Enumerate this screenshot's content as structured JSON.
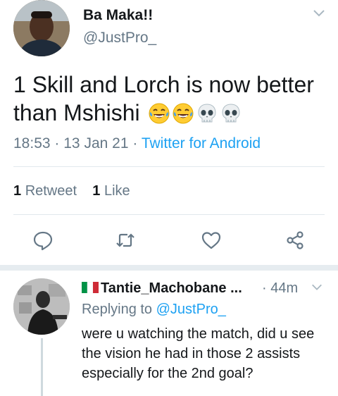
{
  "tweet": {
    "author_name": "Ba Maka!!",
    "author_handle": "@JustPro_",
    "text": "1 Skill and Lorch is now better than Mshishi",
    "emojis": [
      "face-with-tears-of-joy",
      "face-with-tears-of-joy",
      "skull",
      "skull"
    ],
    "time": "18:53",
    "date": "13 Jan 21",
    "source": "Twitter for Android",
    "separator": "·",
    "retweet_count": "1",
    "retweet_label": "Retweet",
    "like_count": "1",
    "like_label": "Like"
  },
  "actions": [
    "reply-icon",
    "retweet-icon",
    "like-icon",
    "share-icon"
  ],
  "reply": {
    "flag": "italy-flag",
    "author_name": "Tantie_Machobane ...",
    "time": "· 44m",
    "replying_prefix": "Replying to",
    "replying_handle": "@JustPro_",
    "text": "were u watching the match, did u see the vision he had in those  2 assists especially for the 2nd goal?"
  },
  "colors": {
    "link": "#1da1f2",
    "secondary_text": "#657786",
    "divider": "#e1e8ed",
    "section_separator": "#e6ecf0"
  }
}
